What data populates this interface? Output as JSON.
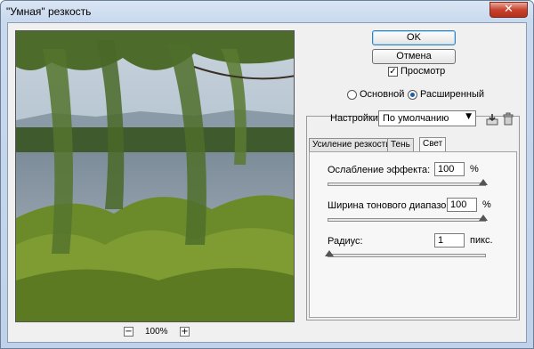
{
  "window": {
    "title": "\"Умная\" резкость",
    "close_symbol": "✕"
  },
  "buttons": {
    "ok": "OK",
    "cancel": "Отмена"
  },
  "preview_toggle": {
    "label": "Просмотр",
    "checked": true,
    "mark": "✓"
  },
  "mode": {
    "basic": "Основной",
    "advanced": "Расширенный",
    "selected": "advanced"
  },
  "settings": {
    "label": "Настройки:",
    "value": "По умолчанию",
    "arrow": "▼"
  },
  "tabs": [
    {
      "label": "Усиление резкости",
      "active": false
    },
    {
      "label": "Тень",
      "active": false
    },
    {
      "label": "Свет",
      "active": true
    }
  ],
  "highlight": {
    "fade": {
      "label": "Ослабление эффекта:",
      "value": "100",
      "unit": "%",
      "level": 1.0
    },
    "tonal_width": {
      "label": "Ширина тонового диапазона:",
      "value": "100",
      "unit": "%",
      "level": 1.0
    },
    "radius": {
      "label": "Радиус:",
      "value": "1",
      "unit": "пикс.",
      "level": 0.0
    }
  },
  "zoom": {
    "minus": "−",
    "value": "100%",
    "plus": "+"
  },
  "colors": {
    "accent": "#1d5fa8",
    "close": "#c7432d",
    "title_bg": "#c9d9ee"
  }
}
